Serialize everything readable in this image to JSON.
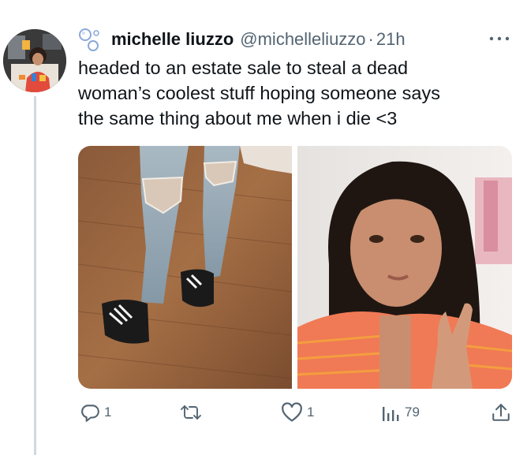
{
  "user": {
    "display_name": "michelle liuzzo",
    "handle": "@michelleliuzzo",
    "separator": "·",
    "time": "21h"
  },
  "icons": {
    "name_badge": "bubbles-icon",
    "more": "more-icon",
    "reply": "reply-icon",
    "retweet": "retweet-icon",
    "like": "heart-icon",
    "views": "views-icon",
    "share": "share-icon"
  },
  "tweet": {
    "text_lines": [
      "headed to an estate sale to steal a dead",
      "woman’s coolest stuff hoping someone says",
      "the same thing about me when i die <3"
    ]
  },
  "media": {
    "count": 2,
    "items": [
      "photo-jeans-sneakers",
      "photo-selfie-peace-sign"
    ]
  },
  "actions": {
    "reply_count": "1",
    "retweet_count": "",
    "like_count": "1",
    "views_count": "79"
  },
  "colors": {
    "text": "#0f1419",
    "secondary": "#536471",
    "thread_line": "#cfd9de"
  }
}
